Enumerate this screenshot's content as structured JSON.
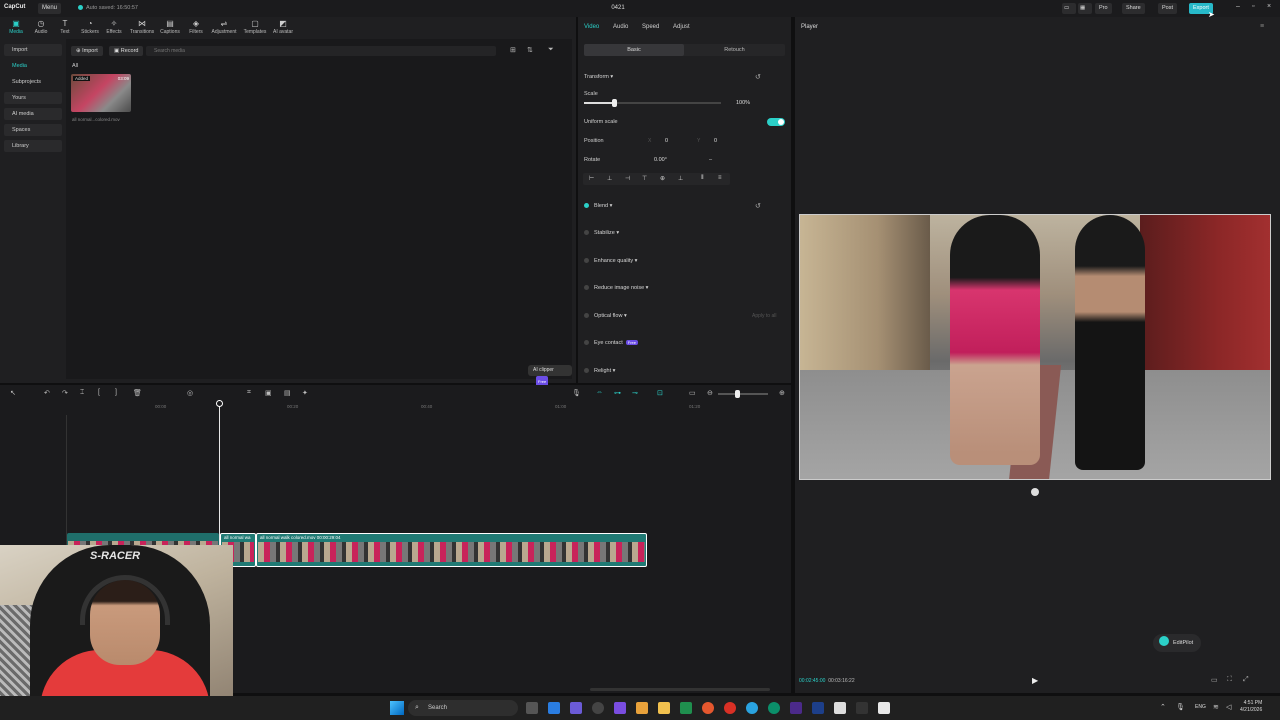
{
  "titlebar": {
    "logo": "CapCut",
    "menu": "Menu",
    "autosave": "Auto saved: 16:50:57",
    "project_title": "0421",
    "buttons": {
      "pro": "Pro",
      "share": "Share",
      "post": "Post",
      "export": "Export"
    }
  },
  "toolbar": {
    "tools": [
      "Media",
      "Audio",
      "Text",
      "Stickers",
      "Effects",
      "Transitions",
      "Captions",
      "Filters",
      "Adjustment",
      "Templates",
      "AI avatar"
    ]
  },
  "sidebar": {
    "items": [
      "Import",
      "Media",
      "Subprojects",
      "Yours",
      "AI media",
      "Spaces",
      "Library"
    ]
  },
  "media": {
    "import_label": "Import",
    "record_label": "Record",
    "search_placeholder": "Search media",
    "filter_all": "All",
    "item": {
      "badge": "Added",
      "duration": "03:09",
      "name": "all normal...colored.mov"
    },
    "ai_clipper": "AI clipper",
    "ai_clipper_badge": "Free"
  },
  "inspector": {
    "tabs": [
      "Video",
      "Audio",
      "Speed",
      "Adjust"
    ],
    "segments": [
      "Basic",
      "Retouch"
    ],
    "transform": "Transform",
    "scale_label": "Scale",
    "scale_value": "100%",
    "scale_fraction": 0.22,
    "uniform_scale": "Uniform scale",
    "position_label": "Position",
    "pos_x_label": "X",
    "pos_x": "0",
    "pos_y_label": "Y",
    "pos_y": "0",
    "rotate_label": "Rotate",
    "rotate_value": "0.00°",
    "rotate_extra": "–",
    "sections": [
      "Blend",
      "Stabilize",
      "Enhance quality",
      "Reduce image noise",
      "Optical flow",
      "Eye contact",
      "Relight"
    ],
    "eye_contact_badge": "Free",
    "apply_to_all": "Apply to all"
  },
  "player": {
    "title": "Player",
    "current_time": "00:02:45:00",
    "total_time": "00:03:16:22",
    "editpilot": "EditPilot"
  },
  "timeline": {
    "ticks": [
      "00:00",
      "00:20",
      "00:40",
      "01:00",
      "01:20"
    ],
    "clip2_label": "all normal wa",
    "clip3_label": "all normal walk colored.mov   00:00:29:04"
  },
  "webcam": {
    "chair_brand": "S-RACER"
  },
  "taskbar": {
    "search": "Search",
    "lang": "ENG",
    "time": "4:51 PM",
    "date": "4/21/2026"
  }
}
